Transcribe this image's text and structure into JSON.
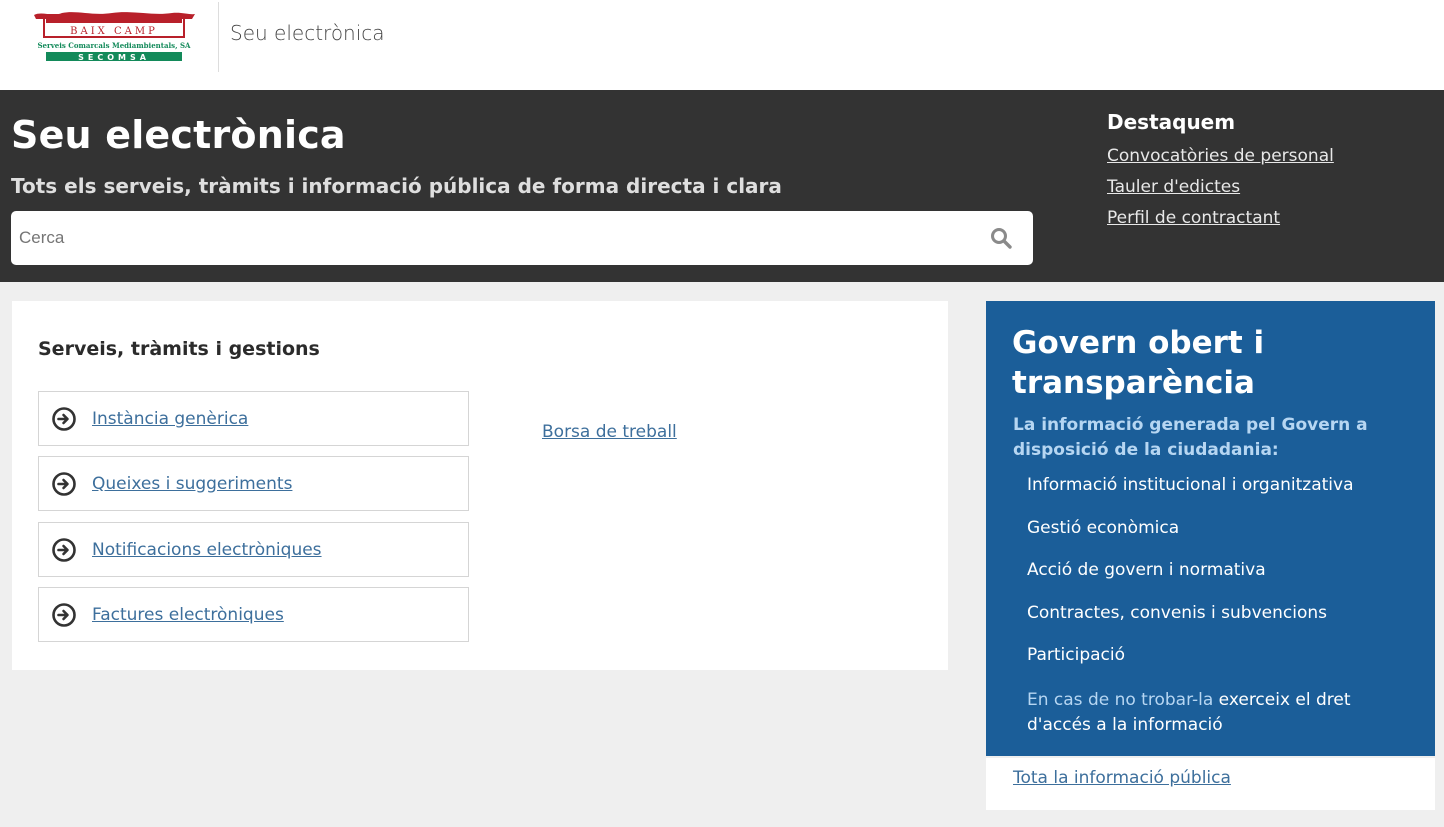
{
  "header": {
    "logo": {
      "top_text": "BAIX CAMP",
      "middle_text": "Serveis Comarcals Mediambientals, SA",
      "bottom_text": "SECOMSA",
      "red": "#b8202a",
      "green": "#138a5a"
    },
    "site_name": "Seu electrònica"
  },
  "hero": {
    "title": "Seu electrònica",
    "subtitle": "Tots els serveis, tràmits i informació pública de forma directa i clara",
    "search": {
      "placeholder": "Cerca",
      "value": "",
      "icon": "search-icon"
    },
    "background": "#333333"
  },
  "featured": {
    "title": "Destaquem",
    "links": [
      "Convocatòries de personal",
      "Tauler d'edictes",
      "Perfil de contractant"
    ]
  },
  "services": {
    "title": "Serveis, tràmits i gestions",
    "items": [
      {
        "label": "Instància genèrica",
        "icon": "arrow-right-circle-icon"
      },
      {
        "label": "Queixes i suggeriments",
        "icon": "arrow-right-circle-icon"
      },
      {
        "label": "Notificacions electròniques",
        "icon": "arrow-right-circle-icon"
      },
      {
        "label": "Factures electròniques",
        "icon": "arrow-right-circle-icon"
      }
    ],
    "side_link": "Borsa de treball"
  },
  "transparency": {
    "title": "Govern obert i transparència",
    "intro": "La informació generada pel Govern a disposició de la ciudadania:",
    "links": [
      "Informació institucional i organitzativa",
      "Gestió econòmica",
      "Acció de govern i normativa",
      "Contractes, convenis i subvencions",
      "Participació"
    ],
    "note_prefix": "En cas de no trobar-la",
    "note_link": "exerceix el dret d'accés a la informació",
    "footer_link": "Tota la informació pública",
    "background": "#1b5e99",
    "link_color": "#3d6f9c"
  }
}
